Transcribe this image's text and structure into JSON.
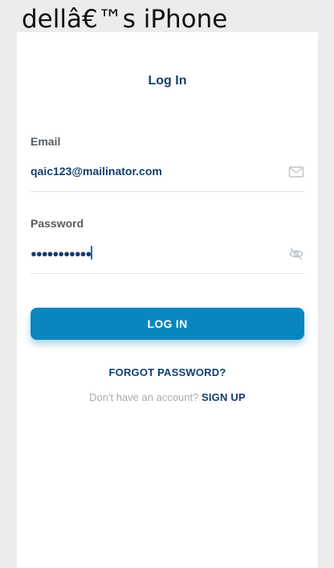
{
  "window": {
    "title": "dellâ€™s iPhone"
  },
  "login": {
    "title": "Log In",
    "email": {
      "label": "Email",
      "value": "qaic123@mailinator.com",
      "icon": "mail-icon"
    },
    "password": {
      "label": "Password",
      "masked_value": "●●●●●●●●●●●",
      "icon": "eye-off-icon"
    },
    "login_button_label": "LOG IN",
    "forgot_password_label": "FORGOT PASSWORD?",
    "signup_prompt": "Don't have an account?",
    "signup_label": "SIGN UP"
  },
  "colors": {
    "primary_button": "#0a86bf",
    "text_dark_blue": "#143c6e",
    "label_gray": "#555b61",
    "muted_gray": "#a6abb0",
    "background": "#ececec",
    "screen": "#ffffff"
  }
}
